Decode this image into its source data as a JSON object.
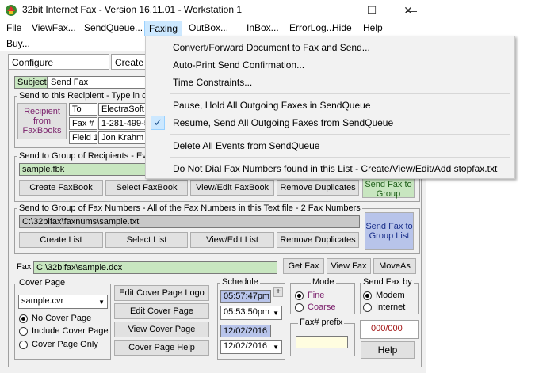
{
  "window": {
    "title": "32bit Internet Fax - Version 16.11.01 - Workstation 1",
    "minimize": "—",
    "maximize": "☐",
    "close": "✕"
  },
  "menu": {
    "file": "File",
    "viewfax": "ViewFax...",
    "sendqueue": "SendQueue...",
    "faxing": "Faxing",
    "outbox": "OutBox...",
    "inbox": "InBox...",
    "errorlog": "ErrorLog...",
    "hide": "Hide",
    "help": "Help",
    "buy": "Buy..."
  },
  "faxing_menu": {
    "items": [
      "Convert/Forward Document to Fax and Send...",
      "Auto-Print Send Confirmation...",
      "Time Constraints...",
      "Pause, Hold All Outgoing Faxes in SendQueue",
      "Resume, Send All Outgoing Faxes from SendQueue",
      "Delete All Events from SendQueue",
      "Do Not Dial Fax Numbers found in this List - Create/View/Edit/Add stopfax.txt"
    ],
    "checkmark": "✓"
  },
  "tabs": {
    "configure": "Configure",
    "create": "Create F"
  },
  "subject": {
    "label": "Subject",
    "value": "Send Fax"
  },
  "recipient": {
    "group_label": "Send to this Recipient - Type in o",
    "button": "Recipient from FaxBooks",
    "to_label": "To",
    "to_value": "ElectraSoft",
    "fax_label": "Fax #",
    "fax_value": "1-281-499-5",
    "field1_label": "Field 1",
    "field1_value": "Jon Krahm"
  },
  "group_recipients": {
    "label": "Send to Group of Recipients - Ev",
    "file": "sample.fbk",
    "create": "Create FaxBook",
    "select": "Select FaxBook",
    "view_edit": "View/Edit FaxBook",
    "remove": "Remove Duplicates",
    "send_button": "Send Fax to Group FaxBook"
  },
  "group_numbers": {
    "label": "Send to Group of Fax Numbers - All of the Fax Numbers in this Text file - 2 Fax Numbers",
    "file": "C:\\32bifax\\faxnums\\sample.txt",
    "create": "Create List",
    "select": "Select List",
    "view_edit": "View/Edit List",
    "remove": "Remove Duplicates",
    "send_button": "Send Fax to Group List"
  },
  "fax_file": {
    "label": "Fax",
    "value": "C:\\32bifax\\sample.dcx",
    "get": "Get Fax",
    "view": "View Fax",
    "moveas": "MoveAs"
  },
  "cover_page": {
    "label": "Cover Page",
    "selected": "sample.cvr",
    "options": [
      "No Cover Page",
      "Include Cover Page",
      "Cover Page Only"
    ],
    "edit_logo": "Edit Cover Page Logo",
    "edit": "Edit Cover Page",
    "view": "View Cover Page",
    "help": "Cover Page Help"
  },
  "schedule": {
    "label": "Schedule",
    "time1": "05:57:47pm",
    "time2": "05:53:50pm",
    "date1": "12/02/2016",
    "date2": "12/02/2016",
    "plus": "+"
  },
  "mode": {
    "label": "Mode",
    "fine": "Fine",
    "coarse": "Coarse"
  },
  "send_by": {
    "label": "Send Fax by",
    "modem": "Modem",
    "internet": "Internet"
  },
  "fax_prefix": {
    "label": "Fax# prefix",
    "value": ""
  },
  "counter": {
    "value": "000/000",
    "help": "Help"
  },
  "colors": {
    "menu_highlight": "#cce8ff",
    "field_green": "#c8e6c0",
    "field_blue": "#b8c4ea",
    "label_purple": "#7a1f6b"
  }
}
